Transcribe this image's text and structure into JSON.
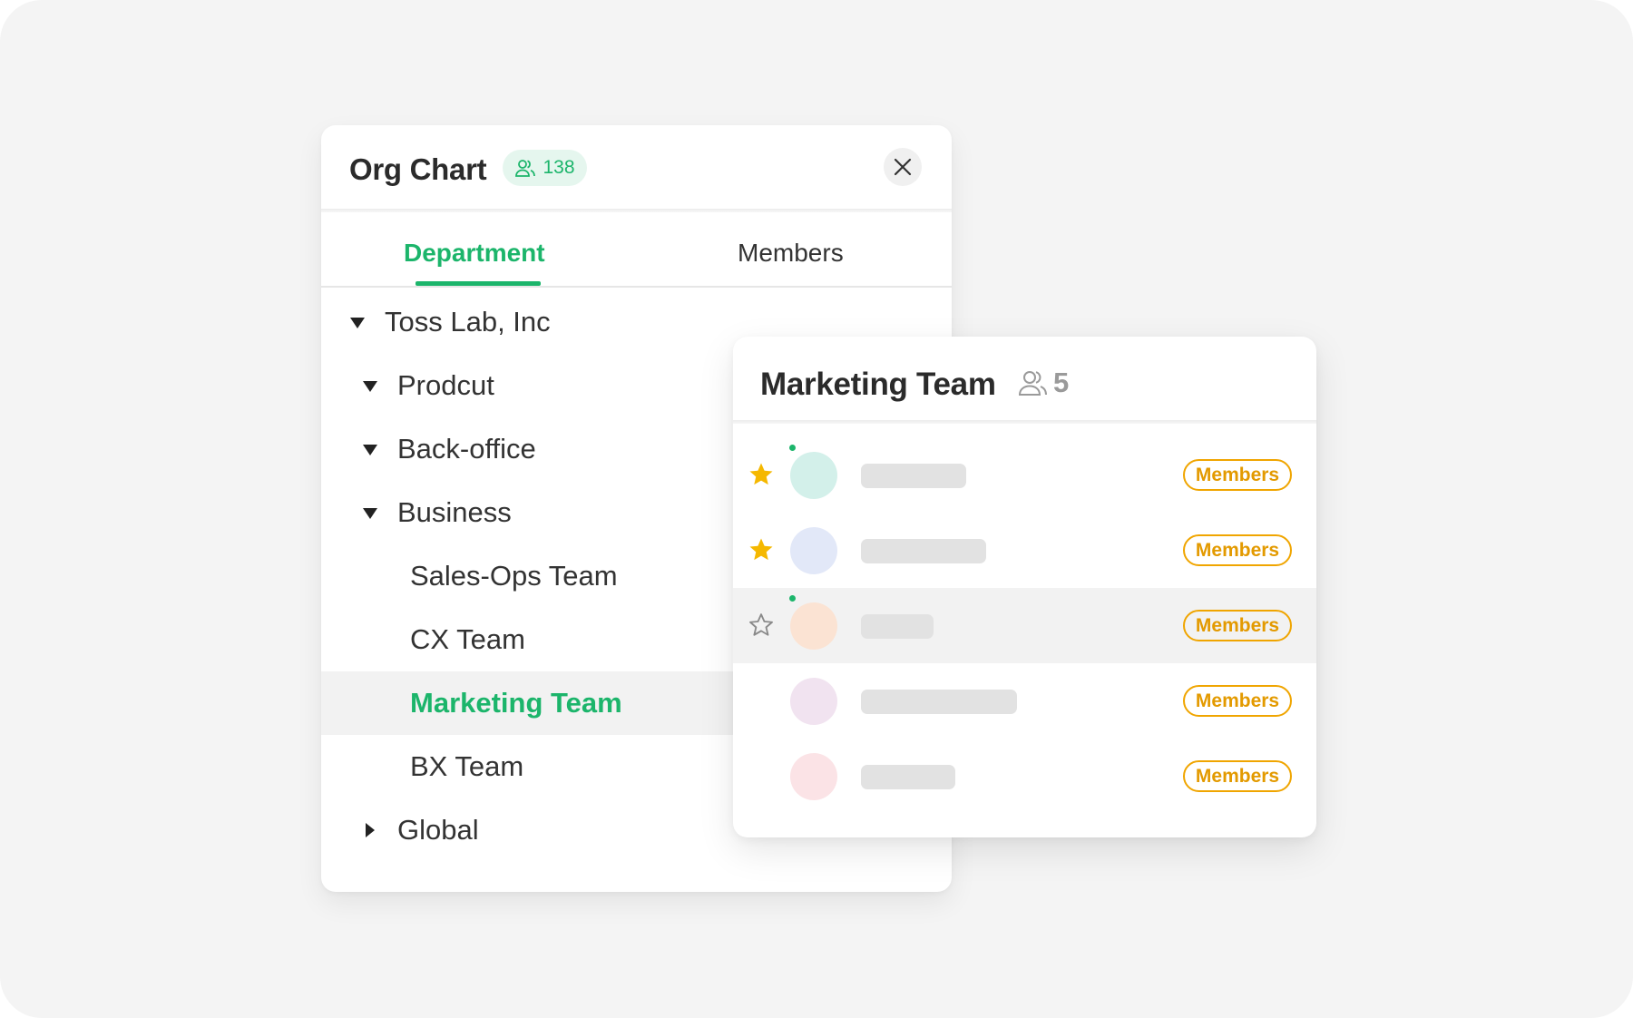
{
  "org_chart": {
    "title": "Org Chart",
    "total_count": "138",
    "close_icon": "close-icon",
    "tabs": [
      {
        "label": "Department",
        "active": true
      },
      {
        "label": "Members",
        "active": false
      }
    ],
    "tree": [
      {
        "label": "Toss Lab, Inc",
        "expanded": true
      },
      {
        "label": "Prodcut",
        "expanded": true
      },
      {
        "label": "Back-office",
        "expanded": true
      },
      {
        "label": "Business",
        "expanded": true
      },
      {
        "label": "Sales-Ops Team"
      },
      {
        "label": "CX Team"
      },
      {
        "label": "Marketing Team",
        "selected": true
      },
      {
        "label": "BX Team"
      },
      {
        "label": "Global",
        "expanded": false
      }
    ]
  },
  "team_panel": {
    "title": "Marketing Team",
    "member_count": "5",
    "members": [
      {
        "favorite": true,
        "online": true,
        "avatar_color": "#d3f0ea",
        "role": "Members"
      },
      {
        "favorite": true,
        "online": false,
        "avatar_color": "#e2e8f8",
        "role": "Members"
      },
      {
        "favorite": false,
        "online": true,
        "avatar_color": "#fbe3d3",
        "role": "Members",
        "highlighted": true
      },
      {
        "favorite": null,
        "online": false,
        "avatar_color": "#f1e3f0",
        "role": "Members"
      },
      {
        "favorite": null,
        "online": false,
        "avatar_color": "#fbe3e6",
        "role": "Members"
      }
    ]
  },
  "colors": {
    "accent_green": "#1cb56b",
    "role_orange": "#f0a500",
    "star_gold": "#f5b800"
  }
}
